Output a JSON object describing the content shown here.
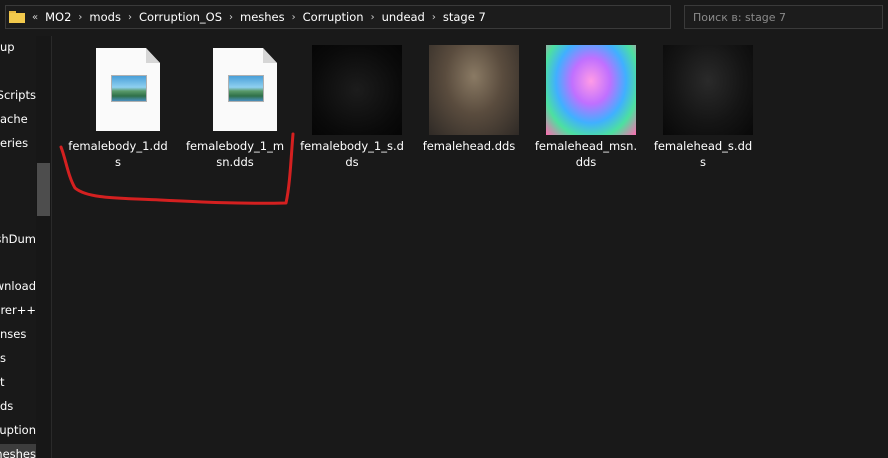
{
  "address_bar": {
    "overflow": "«",
    "separator": "›",
    "path": [
      "MO2",
      "mods",
      "Corruption_OS",
      "meshes",
      "Corruption",
      "undead",
      "stage 7"
    ]
  },
  "search": {
    "placeholder": "Поиск в: stage 7"
  },
  "sidebar": {
    "items": [
      {
        "label": "up"
      },
      {
        "label": "Scripts"
      },
      {
        "label": "ache"
      },
      {
        "label": "eries"
      },
      {
        "label": "shDum"
      },
      {
        "label": "wnload"
      },
      {
        "label": "lorer++"
      },
      {
        "label": "nses"
      },
      {
        "label": "s"
      },
      {
        "label": "t"
      },
      {
        "label": "ds"
      },
      {
        "label": "orruption"
      },
      {
        "label": "meshes"
      }
    ]
  },
  "files": [
    {
      "name": "femalebody_1.dds",
      "icon": "image-file-icon"
    },
    {
      "name": "femalebody_1_msn.dds",
      "icon": "image-file-icon"
    },
    {
      "name": "femalebody_1_s.dds",
      "icon": "texture-thumbnail-dark"
    },
    {
      "name": "femalehead.dds",
      "icon": "texture-thumbnail-head"
    },
    {
      "name": "femalehead_msn.dds",
      "icon": "texture-thumbnail-normal-map"
    },
    {
      "name": "femalehead_s.dds",
      "icon": "texture-thumbnail-specular"
    }
  ],
  "colors": {
    "background": "#191919",
    "text": "#ffffff",
    "folder": "#f2c94c",
    "annotation": "#d42020"
  }
}
